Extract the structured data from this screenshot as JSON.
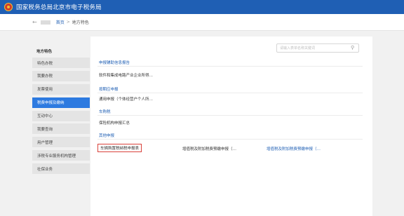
{
  "app": {
    "title": "国家税务总局北京市电子税务局"
  },
  "breadcrumb": {
    "home": "首页",
    "separator": ">",
    "current": "地方特色"
  },
  "sidebar": {
    "title": "地方特色",
    "items": [
      {
        "label": "特色办税"
      },
      {
        "label": "我要办税"
      },
      {
        "label": "发票使用"
      },
      {
        "label": "税费申报及缴纳",
        "active": true
      },
      {
        "label": "互动中心"
      },
      {
        "label": "我要查询"
      },
      {
        "label": "用户管理"
      },
      {
        "label": "涉税专业服务机构管理"
      },
      {
        "label": "社保业务"
      }
    ]
  },
  "search": {
    "placeholder": "请输入表单名称关键词"
  },
  "sections": [
    {
      "title": "申报辅助信息报告",
      "items": [
        "软件和集成电路产业企业所得…"
      ]
    },
    {
      "title": "按期应申报",
      "items": [
        "通用申报（个体经营户个人所…"
      ]
    },
    {
      "title": "车购税",
      "items": [
        "保险机构申报汇总"
      ]
    },
    {
      "title": "其他申报",
      "items": [
        "车辆购置税纳税申报表",
        "增值税及附加税费预缴申报（…",
        "增值税及附加税费预缴申报（…"
      ]
    }
  ],
  "colors": {
    "brand": "#1f5fb4",
    "active": "#2d7ae0",
    "highlight": "#d9413a"
  }
}
